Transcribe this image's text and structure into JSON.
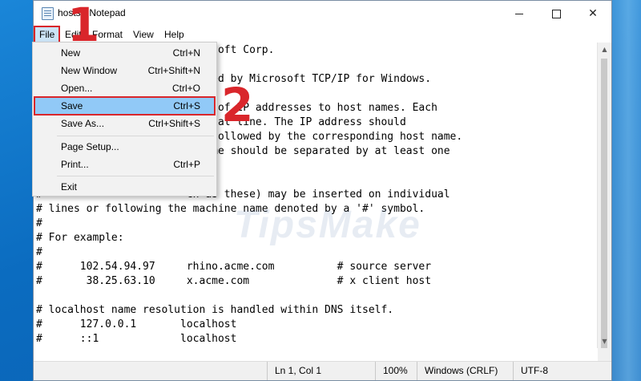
{
  "window": {
    "title": "hosts - Notepad"
  },
  "menubar": {
    "file": "File",
    "edit": "Edit",
    "format": "Format",
    "view": "View",
    "help": "Help"
  },
  "file_menu": {
    "items": [
      {
        "label": "New",
        "shortcut": "Ctrl+N"
      },
      {
        "label": "New Window",
        "shortcut": "Ctrl+Shift+N"
      },
      {
        "label": "Open...",
        "shortcut": "Ctrl+O"
      },
      {
        "label": "Save",
        "shortcut": "Ctrl+S"
      },
      {
        "label": "Save As...",
        "shortcut": "Ctrl+Shift+S"
      },
      {
        "label": "Page Setup...",
        "shortcut": ""
      },
      {
        "label": "Print...",
        "shortcut": "Ctrl+P"
      },
      {
        "label": "Exit",
        "shortcut": ""
      }
    ]
  },
  "editor": {
    "lines": [
      "                        icrosoft Corp.",
      "",
      "                        e used by Microsoft TCP/IP for Windows.",
      "",
      "                        ping of IP addresses to host names. Each",
      "                        ividual line. The IP address should",
      "                        umn followed by the corresponding host name.",
      "                        t name should be separated by at least one",
      "",
      "",
      "#                       ch as these) may be inserted on individual",
      "# lines or following the machine name denoted by a '#' symbol.",
      "#",
      "# For example:",
      "#",
      "#      102.54.94.97     rhino.acme.com          # source server",
      "#       38.25.63.10     x.acme.com              # x client host",
      "",
      "# localhost name resolution is handled within DNS itself.",
      "#      127.0.0.1       localhost",
      "#      ::1             localhost"
    ]
  },
  "statusbar": {
    "position": "Ln 1, Col 1",
    "zoom": "100%",
    "line_endings": "Windows (CRLF)",
    "encoding": "UTF-8"
  },
  "annotations": {
    "step1": "1",
    "step2": "2"
  },
  "watermark": {
    "text": "TipsMake"
  },
  "colors": {
    "highlight_red": "#d9262b",
    "menu_hover": "#91c9f7",
    "desktop": "#0b6cc0"
  }
}
